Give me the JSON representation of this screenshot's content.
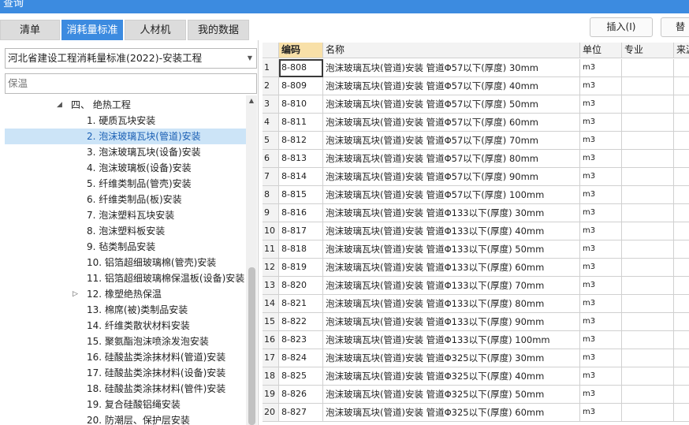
{
  "window": {
    "title": "查询"
  },
  "tabs": [
    {
      "label": "清单",
      "active": false
    },
    {
      "label": "消耗量标准",
      "active": true
    },
    {
      "label": "人材机",
      "active": false
    },
    {
      "label": "我的数据",
      "active": false
    }
  ],
  "toolbar": {
    "insert_label": "插入(I)",
    "replace_label": "替"
  },
  "standard_select": {
    "value": "河北省建设工程消耗量标准(2022)-安装工程"
  },
  "search": {
    "value": "保温"
  },
  "tree": {
    "parent": {
      "label": "四、 绝热工程",
      "expanded": true
    },
    "items": [
      {
        "label": "1. 硬质瓦块安装"
      },
      {
        "label": "2. 泡沫玻璃瓦块(管道)安装",
        "selected": true
      },
      {
        "label": "3. 泡沫玻璃瓦块(设备)安装"
      },
      {
        "label": "4. 泡沫玻璃板(设备)安装"
      },
      {
        "label": "5. 纤维类制品(管壳)安装"
      },
      {
        "label": "6. 纤维类制品(板)安装"
      },
      {
        "label": "7. 泡沫塑料瓦块安装"
      },
      {
        "label": "8. 泡沫塑料板安装"
      },
      {
        "label": "9. 毡类制品安装"
      },
      {
        "label": "10. 铝箔超细玻璃棉(管壳)安装"
      },
      {
        "label": "11. 铝箔超细玻璃棉保温板(设备)安装"
      },
      {
        "label": "12. 橡塑绝热保温",
        "collapsed": true
      },
      {
        "label": "13. 棉席(被)类制品安装"
      },
      {
        "label": "14. 纤维类散状材料安装"
      },
      {
        "label": "15. 聚氨酯泡沫喷涂发泡安装"
      },
      {
        "label": "16. 硅酸盐类涂抹材料(管道)安装"
      },
      {
        "label": "17. 硅酸盐类涂抹材料(设备)安装"
      },
      {
        "label": "18. 硅酸盐类涂抹材料(管件)安装"
      },
      {
        "label": "19. 复合硅酸铝绳安装"
      },
      {
        "label": "20. 防潮层、保护层安装"
      }
    ]
  },
  "grid": {
    "headers": {
      "code": "编码",
      "name": "名称",
      "unit": "单位",
      "specialty": "专业",
      "source": "来源"
    },
    "rows": [
      {
        "num": "1",
        "code": "8-808",
        "name": "泡沫玻璃瓦块(管道)安装 管道Φ57以下(厚度) 30mm",
        "unit": "m3"
      },
      {
        "num": "2",
        "code": "8-809",
        "name": "泡沫玻璃瓦块(管道)安装 管道Φ57以下(厚度) 40mm",
        "unit": "m3"
      },
      {
        "num": "3",
        "code": "8-810",
        "name": "泡沫玻璃瓦块(管道)安装 管道Φ57以下(厚度) 50mm",
        "unit": "m3"
      },
      {
        "num": "4",
        "code": "8-811",
        "name": "泡沫玻璃瓦块(管道)安装 管道Φ57以下(厚度) 60mm",
        "unit": "m3"
      },
      {
        "num": "5",
        "code": "8-812",
        "name": "泡沫玻璃瓦块(管道)安装 管道Φ57以下(厚度) 70mm",
        "unit": "m3"
      },
      {
        "num": "6",
        "code": "8-813",
        "name": "泡沫玻璃瓦块(管道)安装 管道Φ57以下(厚度) 80mm",
        "unit": "m3"
      },
      {
        "num": "7",
        "code": "8-814",
        "name": "泡沫玻璃瓦块(管道)安装 管道Φ57以下(厚度) 90mm",
        "unit": "m3"
      },
      {
        "num": "8",
        "code": "8-815",
        "name": "泡沫玻璃瓦块(管道)安装 管道Φ57以下(厚度) 100mm",
        "unit": "m3"
      },
      {
        "num": "9",
        "code": "8-816",
        "name": "泡沫玻璃瓦块(管道)安装 管道Φ133以下(厚度) 30mm",
        "unit": "m3"
      },
      {
        "num": "10",
        "code": "8-817",
        "name": "泡沫玻璃瓦块(管道)安装 管道Φ133以下(厚度) 40mm",
        "unit": "m3"
      },
      {
        "num": "11",
        "code": "8-818",
        "name": "泡沫玻璃瓦块(管道)安装 管道Φ133以下(厚度) 50mm",
        "unit": "m3"
      },
      {
        "num": "12",
        "code": "8-819",
        "name": "泡沫玻璃瓦块(管道)安装 管道Φ133以下(厚度) 60mm",
        "unit": "m3"
      },
      {
        "num": "13",
        "code": "8-820",
        "name": "泡沫玻璃瓦块(管道)安装 管道Φ133以下(厚度) 70mm",
        "unit": "m3"
      },
      {
        "num": "14",
        "code": "8-821",
        "name": "泡沫玻璃瓦块(管道)安装 管道Φ133以下(厚度) 80mm",
        "unit": "m3"
      },
      {
        "num": "15",
        "code": "8-822",
        "name": "泡沫玻璃瓦块(管道)安装 管道Φ133以下(厚度) 90mm",
        "unit": "m3"
      },
      {
        "num": "16",
        "code": "8-823",
        "name": "泡沫玻璃瓦块(管道)安装 管道Φ133以下(厚度) 100mm",
        "unit": "m3"
      },
      {
        "num": "17",
        "code": "8-824",
        "name": "泡沫玻璃瓦块(管道)安装 管道Φ325以下(厚度) 30mm",
        "unit": "m3"
      },
      {
        "num": "18",
        "code": "8-825",
        "name": "泡沫玻璃瓦块(管道)安装 管道Φ325以下(厚度) 40mm",
        "unit": "m3"
      },
      {
        "num": "19",
        "code": "8-826",
        "name": "泡沫玻璃瓦块(管道)安装 管道Φ325以下(厚度) 50mm",
        "unit": "m3"
      },
      {
        "num": "20",
        "code": "8-827",
        "name": "泡沫玻璃瓦块(管道)安装 管道Φ325以下(厚度) 60mm",
        "unit": "m3"
      }
    ]
  },
  "colors": {
    "accent": "#3c8be0",
    "selection": "#cce4f7",
    "header_highlight": "#f8e0a8"
  }
}
